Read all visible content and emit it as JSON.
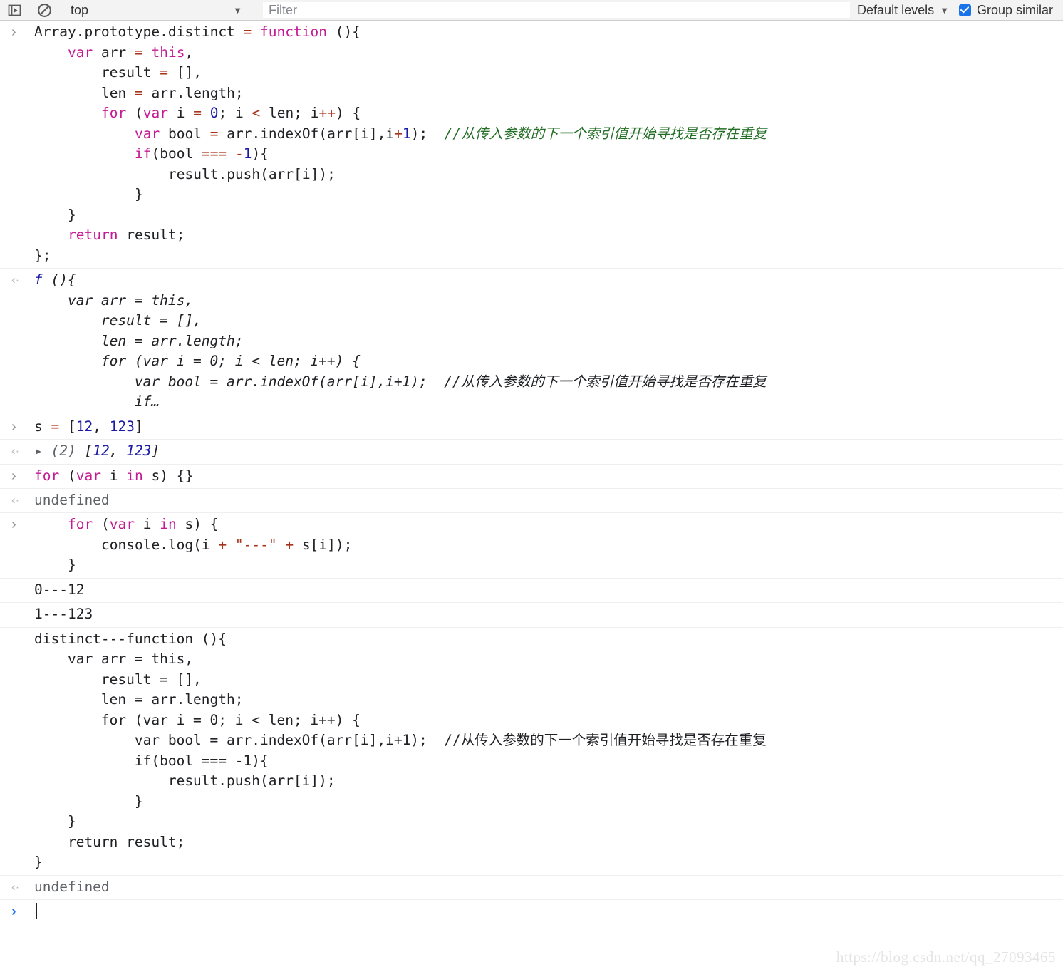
{
  "toolbar": {
    "drawer_icon": "show-drawer-icon",
    "clear_icon": "clear-console-icon",
    "context_value": "top",
    "context_caret": "▼",
    "filter_placeholder": "Filter",
    "filter_value": "",
    "levels_label": "Default levels",
    "levels_caret": "▼",
    "group_similar_label": "Group similar",
    "group_similar_checked": true,
    "checkbox_color": "#1a73e8",
    "check_glyph": "✓"
  },
  "gutter": {
    "input": "›",
    "output": "‹·"
  },
  "console": {
    "rows": [
      {
        "kind": "input",
        "lines": [
          "Array.prototype.distinct = function (){",
          "    var arr = this,",
          "        result = [],",
          "        len = arr.length;",
          "        for (var i = 0; i < len; i++) {",
          "            var bool = arr.indexOf(arr[i],i+1);  //从传入参数的下一个索引值开始寻找是否存在重复",
          "            if(bool === -1){",
          "                result.push(arr[i]);",
          "            }",
          "    }",
          "    return result;",
          "};"
        ]
      },
      {
        "kind": "output-function",
        "lines": [
          "f (){",
          "    var arr = this,",
          "        result = [],",
          "        len = arr.length;",
          "        for (var i = 0; i < len; i++) {",
          "            var bool = arr.indexOf(arr[i],i+1);  //从传入参数的下一个索引值开始寻找是否存在重复",
          "            if…"
        ]
      },
      {
        "kind": "input",
        "lines": [
          "s = [12, 123]"
        ]
      },
      {
        "kind": "output-array",
        "disclosure": "▸",
        "prefix": "(2)",
        "value": "[12, 123]"
      },
      {
        "kind": "input",
        "lines": [
          "for (var i in s) {}"
        ]
      },
      {
        "kind": "output-undefined",
        "value": "undefined"
      },
      {
        "kind": "input",
        "lines": [
          "    for (var i in s) {",
          "        console.log(i + \"---\" + s[i]);",
          "    }"
        ]
      },
      {
        "kind": "log",
        "lines": [
          "0---12"
        ]
      },
      {
        "kind": "log",
        "lines": [
          "1---123"
        ]
      },
      {
        "kind": "log",
        "lines": [
          "distinct---function (){",
          "    var arr = this,",
          "        result = [],",
          "        len = arr.length;",
          "        for (var i = 0; i < len; i++) {",
          "            var bool = arr.indexOf(arr[i],i+1);  //从传入参数的下一个索引值开始寻找是否存在重复",
          "            if(bool === -1){",
          "                result.push(arr[i]);",
          "            }",
          "    }",
          "    return result;",
          "}"
        ]
      },
      {
        "kind": "output-undefined",
        "value": "undefined"
      },
      {
        "kind": "prompt",
        "value": ""
      }
    ]
  },
  "watermark": {
    "text": "https://blog.csdn.net/qq_27093465"
  }
}
